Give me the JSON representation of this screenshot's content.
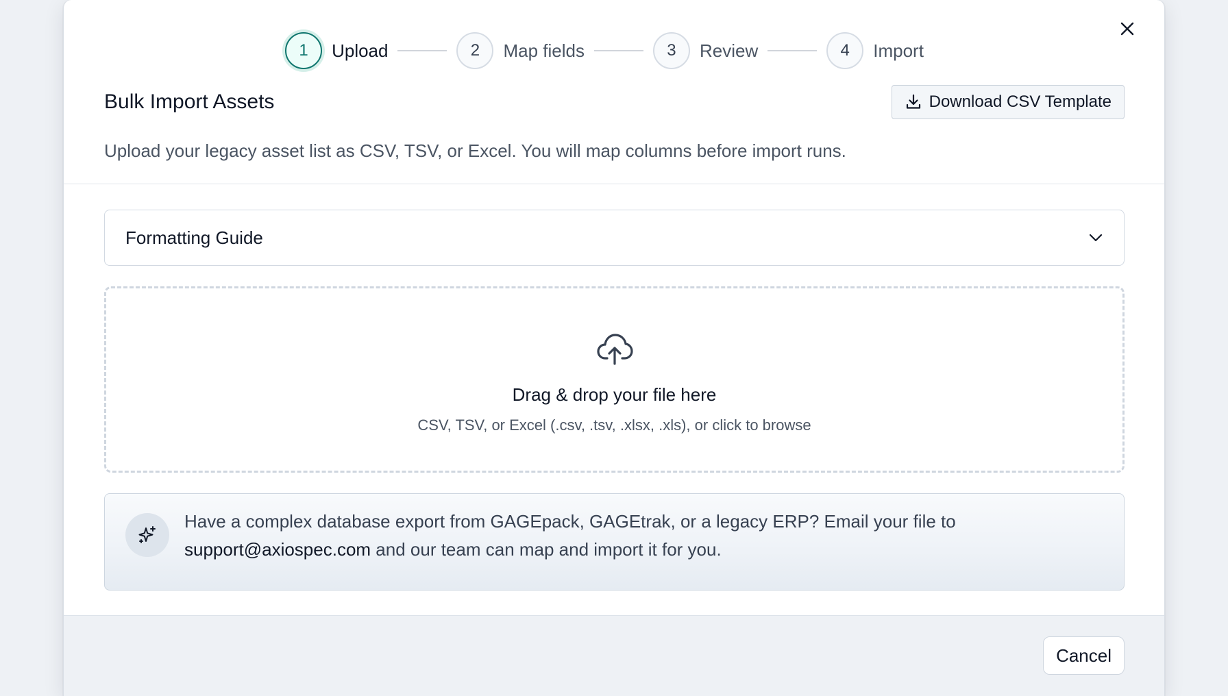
{
  "stepper": {
    "steps": [
      {
        "number": "1",
        "label": "Upload",
        "active": true
      },
      {
        "number": "2",
        "label": "Map fields",
        "active": false
      },
      {
        "number": "3",
        "label": "Review",
        "active": false
      },
      {
        "number": "4",
        "label": "Import",
        "active": false
      }
    ]
  },
  "header": {
    "title": "Bulk Import Assets",
    "subtitle": "Upload your legacy asset list as CSV, TSV, or Excel. You will map columns before import runs.",
    "download_label": "Download CSV Template"
  },
  "accordion": {
    "title": "Formatting Guide"
  },
  "dropzone": {
    "title": "Drag & drop your file here",
    "subtitle": "CSV, TSV, or Excel (.csv, .tsv, .xlsx, .xls), or click to browse"
  },
  "info": {
    "text_before": "Have a complex database export from GAGEpack, GAGEtrak, or a legacy ERP? Email your file to ",
    "email": "support@axiospec.com",
    "text_after": " and our team can map and import it for you."
  },
  "footer": {
    "cancel_label": "Cancel"
  },
  "colors": {
    "accent": "#0f766e",
    "accent_bg": "#ecfdf9",
    "page_bg": "#eef1f5"
  },
  "icons": {
    "close": "close-icon",
    "download": "download-icon",
    "chevron": "chevron-down-icon",
    "upload": "cloud-upload-icon",
    "sparkle": "sparkles-icon"
  }
}
